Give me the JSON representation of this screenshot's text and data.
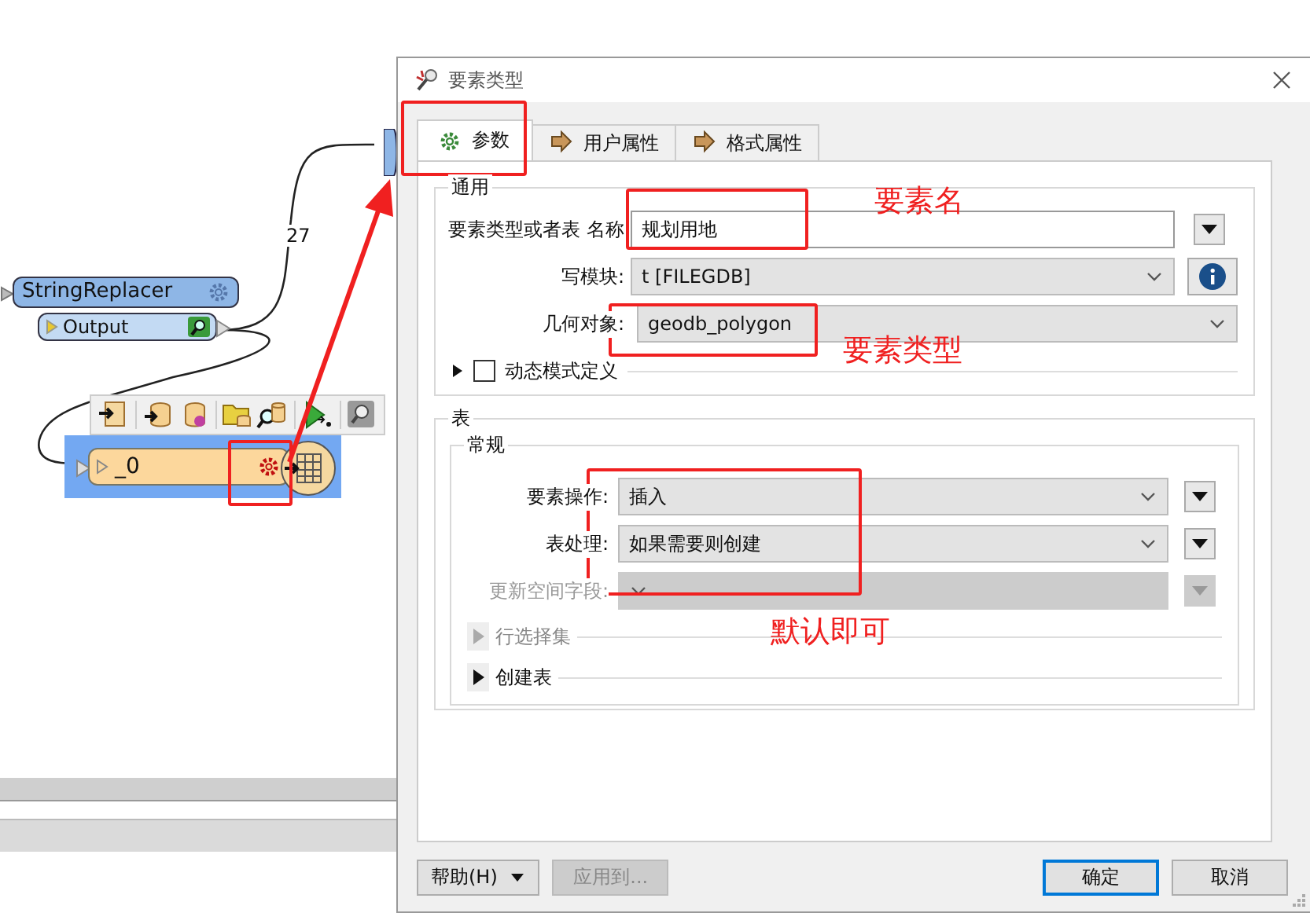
{
  "canvas": {
    "connection_label": "27",
    "transformer": {
      "name": "StringReplacer",
      "port": "Output"
    },
    "writer_node": {
      "name": "_0",
      "selected": true
    }
  },
  "dialog": {
    "title": "要素类型",
    "tabs": [
      {
        "label": "参数",
        "kind": "gear",
        "selected": true
      },
      {
        "label": "用户属性",
        "kind": "arrow",
        "selected": false
      },
      {
        "label": "格式属性",
        "kind": "arrow",
        "selected": false
      }
    ],
    "general": {
      "title": "通用",
      "fields": [
        {
          "kind": "text",
          "label": "要素类型或者表 名称",
          "value": "规划用地"
        },
        {
          "kind": "select",
          "label": "写模块:",
          "value": "t [FILEGDB]"
        },
        {
          "kind": "wide",
          "label": "几何对象:",
          "value": "geodb_polygon"
        }
      ],
      "dynamic": {
        "label": "动态模式定义",
        "checked": false,
        "expanded": false
      }
    },
    "table": {
      "title": "表",
      "group": "常规",
      "fields": [
        {
          "label": "要素操作:",
          "value": "插入",
          "disabled": false
        },
        {
          "label": "表处理:",
          "value": "如果需要则创建",
          "disabled": false
        },
        {
          "label": "更新空间字段:",
          "disabled": true
        }
      ],
      "sections": [
        {
          "label": "行选择集",
          "disabled": true,
          "expanded": false
        },
        {
          "label": "创建表",
          "disabled": false,
          "expanded": false
        }
      ]
    },
    "buttons": [
      {
        "label": "帮助(H)",
        "kind": "menu",
        "disabled": false,
        "default": false
      },
      {
        "label": "应用到...",
        "kind": "plain",
        "disabled": true,
        "default": false
      },
      {
        "label": "确定",
        "kind": "plain",
        "disabled": false,
        "default": true
      },
      {
        "label": "取消",
        "kind": "plain",
        "disabled": false,
        "default": false
      }
    ]
  },
  "annotations": [
    {
      "text": "要素名",
      "kind": "note"
    },
    {
      "text": "要素类型",
      "kind": "note"
    },
    {
      "text": "默认即可",
      "kind": "note"
    }
  ]
}
